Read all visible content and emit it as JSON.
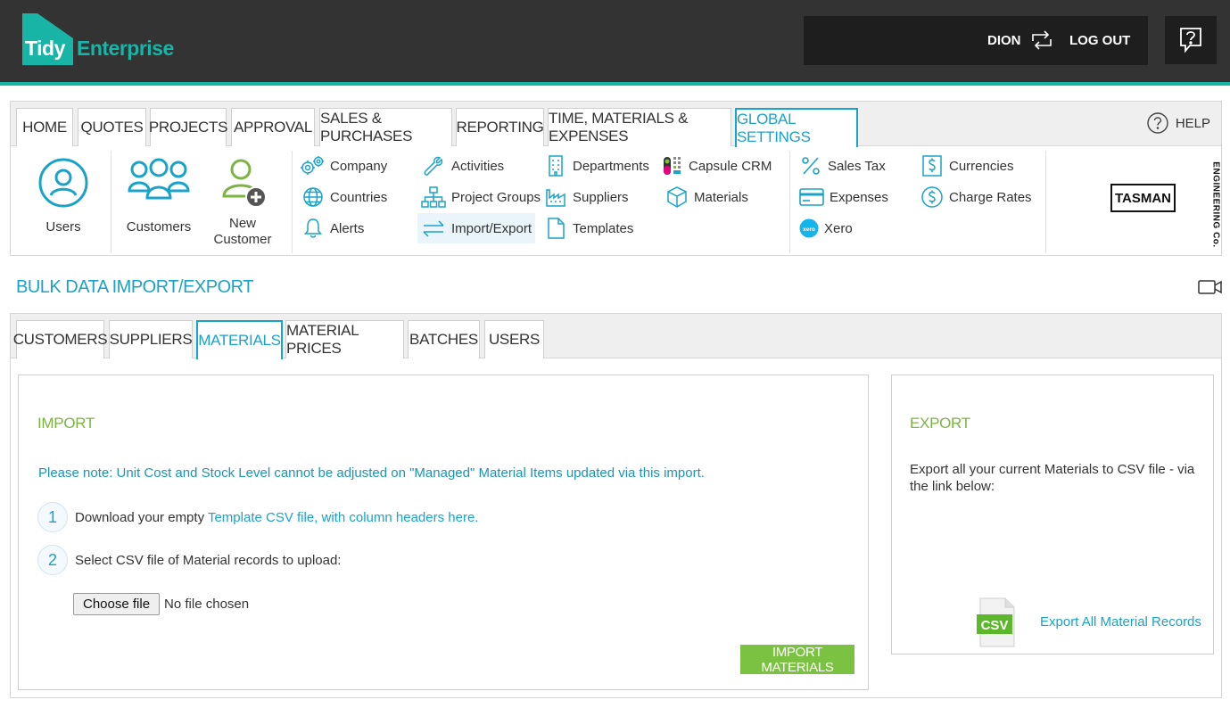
{
  "header": {
    "logo_tidy": "Tidy",
    "logo_enterprise": "Enterprise",
    "username": "DION",
    "logout_label": "LOG OUT",
    "colors": {
      "bar": "#333333",
      "accent": "#18b4a6"
    }
  },
  "nav": {
    "tabs": [
      "HOME",
      "QUOTES",
      "PROJECTS",
      "APPROVAL",
      "SALES & PURCHASES",
      "REPORTING",
      "TIME, MATERIALS & EXPENSES",
      "GLOBAL SETTINGS"
    ],
    "active_tab": "GLOBAL SETTINGS",
    "help_label": "HELP",
    "big_items": {
      "users": "Users",
      "customers": "Customers",
      "new_customer_1": "New",
      "new_customer_2": "Customer"
    },
    "menu": {
      "company": "Company",
      "countries": "Countries",
      "alerts": "Alerts",
      "activities": "Activities",
      "project_groups": "Project Groups",
      "import_export": "Import/Export",
      "departments": "Departments",
      "suppliers": "Suppliers",
      "templates": "Templates",
      "capsule_crm": "Capsule CRM",
      "materials": "Materials",
      "sales_tax": "Sales Tax",
      "expenses": "Expenses",
      "xero": "Xero",
      "currencies": "Currencies",
      "charge_rates": "Charge Rates"
    },
    "company_logo": {
      "name": "TASMAN",
      "sub": "ENGINEERING Co."
    }
  },
  "page": {
    "title": "BULK DATA IMPORT/EXPORT",
    "subtabs": [
      "CUSTOMERS",
      "SUPPLIERS",
      "MATERIALS",
      "MATERIAL PRICES",
      "BATCHES",
      "USERS"
    ],
    "active_subtab": "MATERIALS"
  },
  "import": {
    "heading": "IMPORT",
    "note": "Please note: Unit Cost and Stock Level cannot be adjusted on \"Managed\" Material Items updated via this import.",
    "step1_num": "1",
    "step1_text": "Download your empty ",
    "step1_link": "Template CSV file, with column headers here.",
    "step2_num": "2",
    "step2_text": "Select CSV file of Material records to upload:",
    "choose_file": "Choose file",
    "no_file": "No file chosen",
    "button": "IMPORT MATERIALS"
  },
  "export": {
    "heading": "EXPORT",
    "text": "Export all your current Materials to CSV file - via the link below:",
    "csv_label": "CSV",
    "link": "Export All Material Records"
  }
}
